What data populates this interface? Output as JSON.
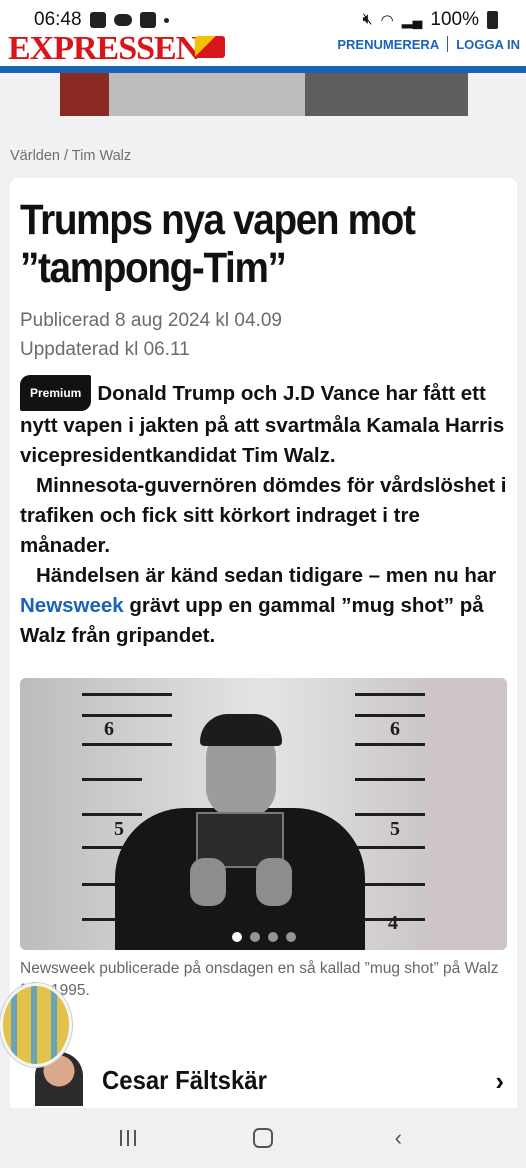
{
  "status_bar": {
    "time": "06:48",
    "battery": "100%",
    "icons": [
      "image-icon",
      "cloud-icon",
      "check-box-icon",
      "mute-icon",
      "wifi-icon",
      "signal-icon",
      "battery-icon"
    ]
  },
  "header": {
    "logo_text": "EXPRESSEN",
    "subscribe": "PRENUMERERA",
    "login": "LOGGA IN",
    "brand_color": "#d7151b",
    "accent_color": "#1a63b7"
  },
  "breadcrumb": "Världen / Tim Walz",
  "article": {
    "headline_line1": "Trumps nya vapen mot",
    "headline_line2": "”tampong-Tim”",
    "published": "Publicerad 8 aug 2024 kl 04.09",
    "updated": "Uppdaterad kl 06.11",
    "premium_label": "Premium",
    "para1": "Donald Trump och J.D Vance har fått ett nytt vapen i jakten på att svartmåla Kamala Harris vicepresidentkandidat Tim Walz.",
    "para2": "Minnesota-guvernören dömdes för vårdslöshet i trafiken och fick sitt körkort indraget i tre månader.",
    "para3_before": "Händelsen är känd sedan tidigare – men nu har",
    "para3_link": "Newsweek",
    "para3_after": "grävt upp en gammal ”mug shot” på Walz från gripandet.",
    "photo": {
      "height_labels": [
        "6",
        "6",
        "5",
        "5",
        "4"
      ],
      "carousel_count": 4,
      "active_index": 0
    },
    "caption": "Newsweek publicerade på onsdagen en så kallad ”mug shot” på Walz från 1995."
  },
  "author": {
    "name": "Cesar Fältskär"
  }
}
